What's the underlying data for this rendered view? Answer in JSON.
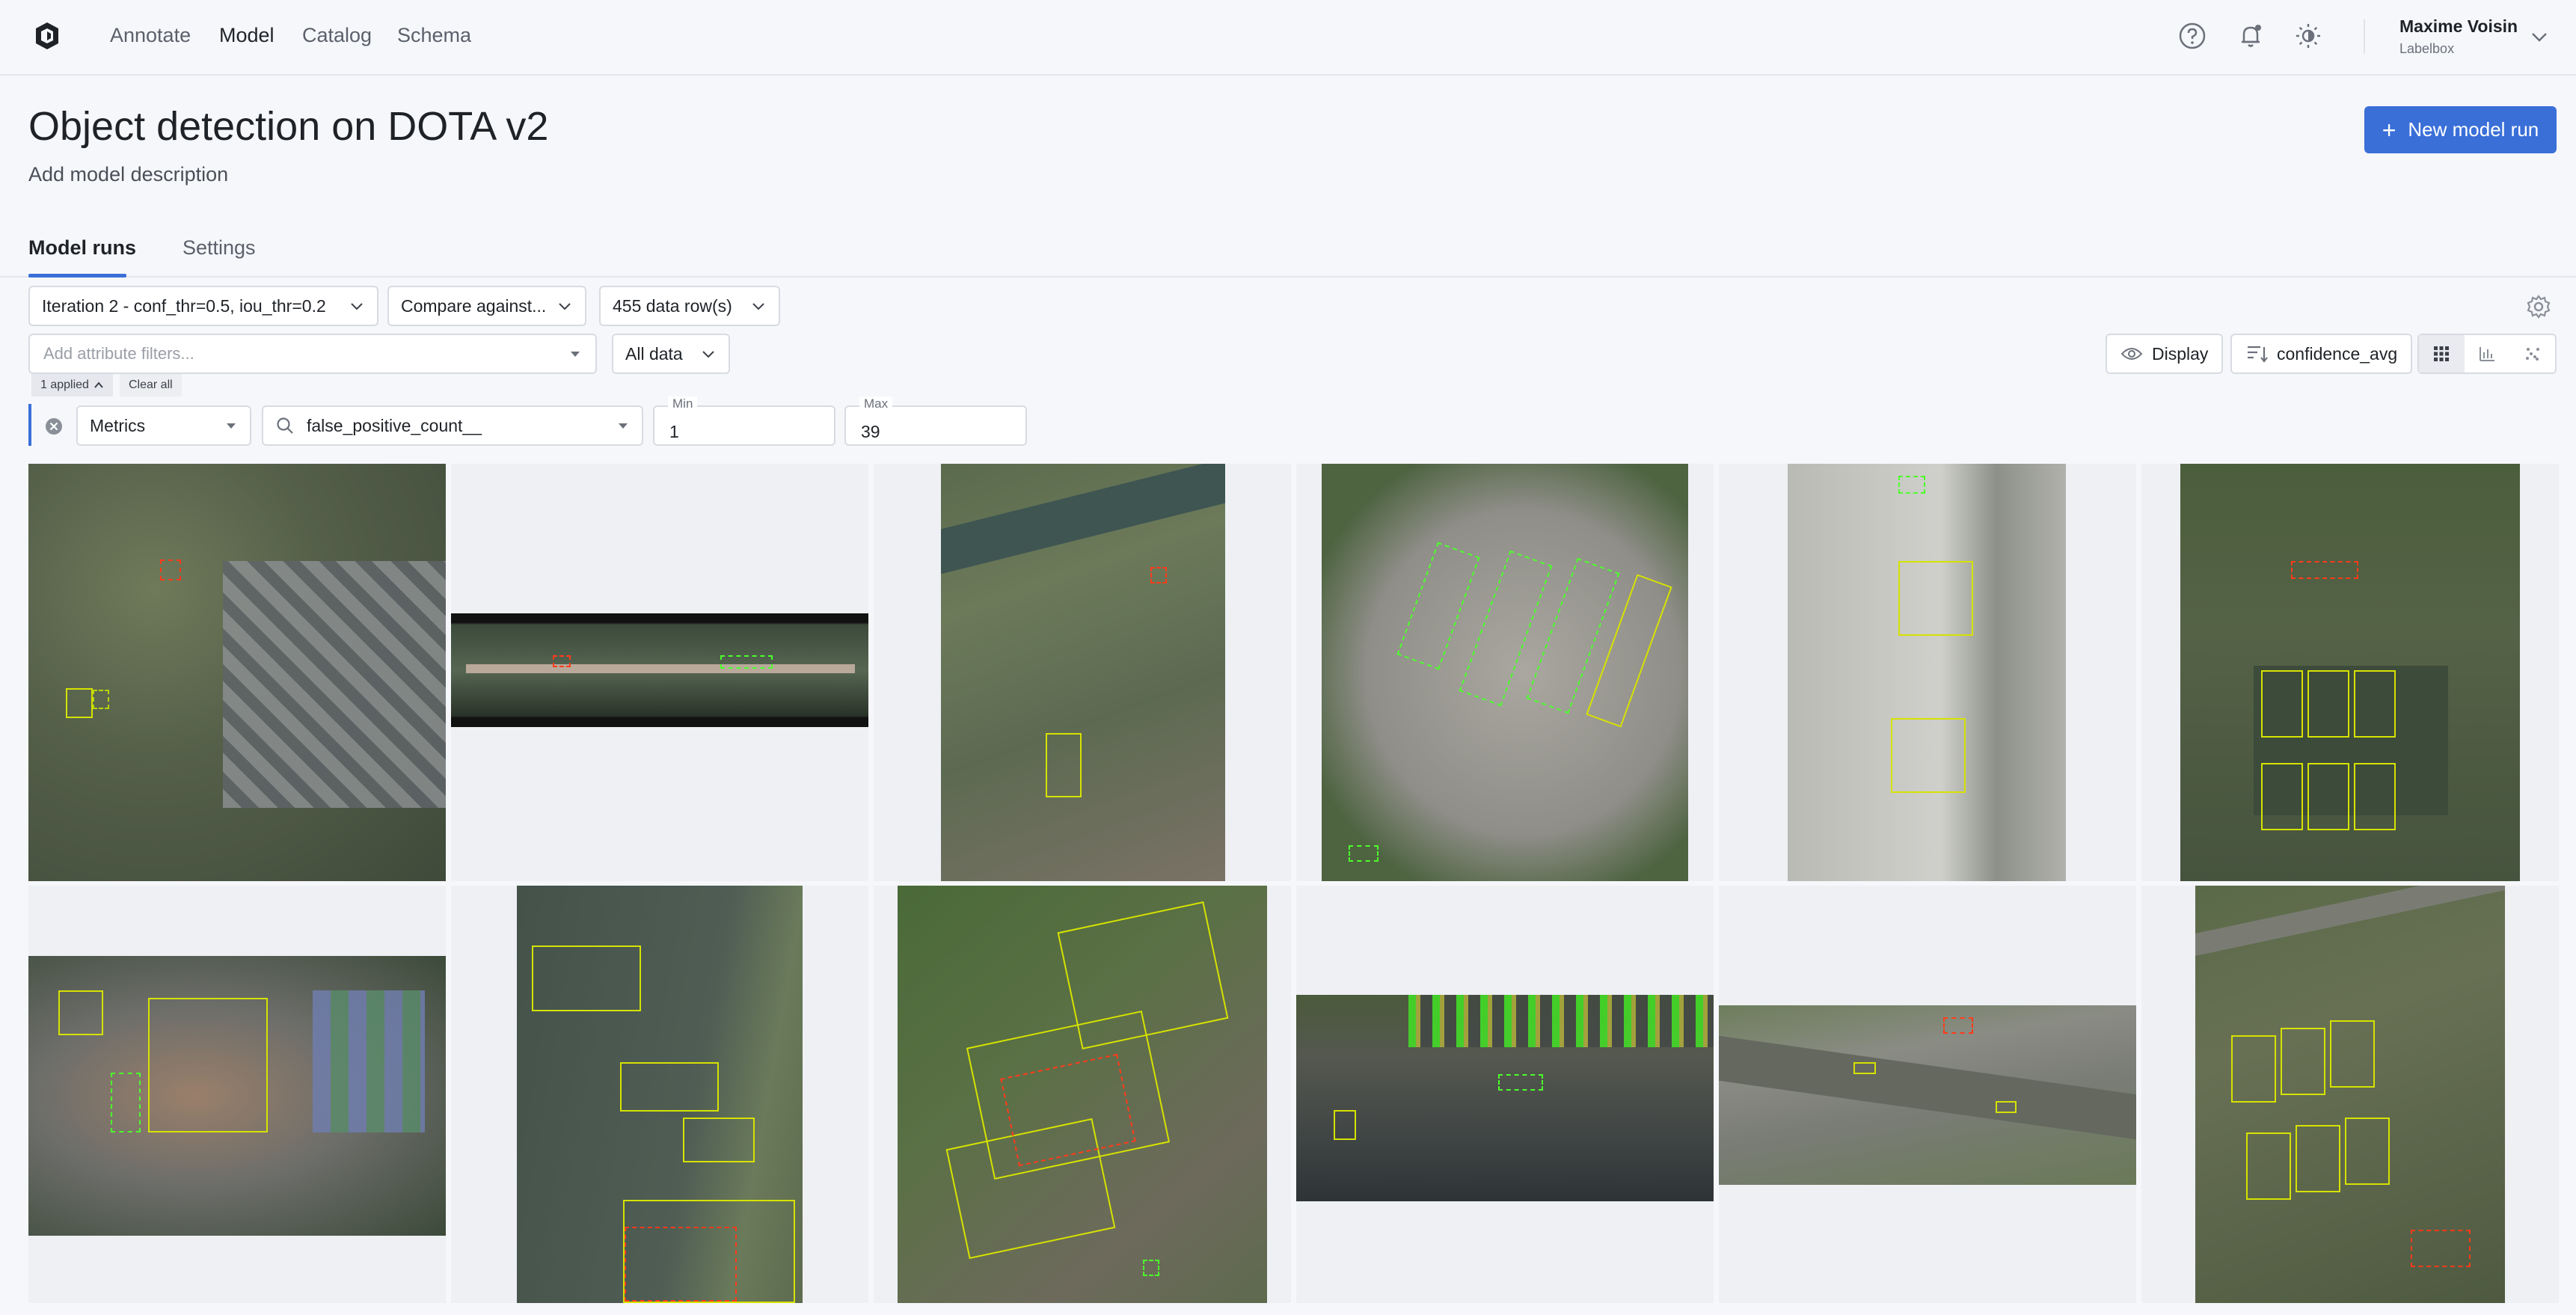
{
  "nav": {
    "links": [
      "Annotate",
      "Model",
      "Catalog",
      "Schema"
    ],
    "active": "Model",
    "icons": [
      "help-icon",
      "notification-bell-icon",
      "theme-toggle-icon"
    ],
    "user": {
      "name": "Maxime Voisin",
      "org": "Labelbox"
    }
  },
  "header": {
    "title": "Object detection on DOTA v2",
    "description": "Add model description",
    "new_run_label": "New model run"
  },
  "tabs": [
    "Model runs",
    "Settings"
  ],
  "controls": {
    "iteration": "Iteration 2 - conf_thr=0.5, iou_thr=0.2",
    "compare": "Compare against...",
    "rows": "455 data row(s)",
    "attribute_placeholder": "Add attribute filters...",
    "data_scope": "All data",
    "applied": "1 applied",
    "clear_all": "Clear all",
    "display": "Display",
    "sort_metric": "confidence_avg"
  },
  "filter": {
    "category": "Metrics",
    "metric": "false_positive_count__",
    "min_label": "Min",
    "min_value": "1",
    "max_label": "Max",
    "max_value": "39"
  },
  "colors": {
    "accent": "#3a6fd8",
    "prediction": "#4cff2b",
    "ground_truth": "#d6e200",
    "false_positive": "#ff3b1a"
  },
  "tiles": [
    {
      "scene": "suburban-aerial"
    },
    {
      "scene": "bridge-water"
    },
    {
      "scene": "farmland-river"
    },
    {
      "scene": "bus-depot"
    },
    {
      "scene": "airport-planes"
    },
    {
      "scene": "sports-courts"
    },
    {
      "scene": "stadium-track"
    },
    {
      "scene": "harbor-pier"
    },
    {
      "scene": "solar-warehouse"
    },
    {
      "scene": "parking-lot"
    },
    {
      "scene": "airfield-runway"
    },
    {
      "scene": "solar-park"
    }
  ]
}
